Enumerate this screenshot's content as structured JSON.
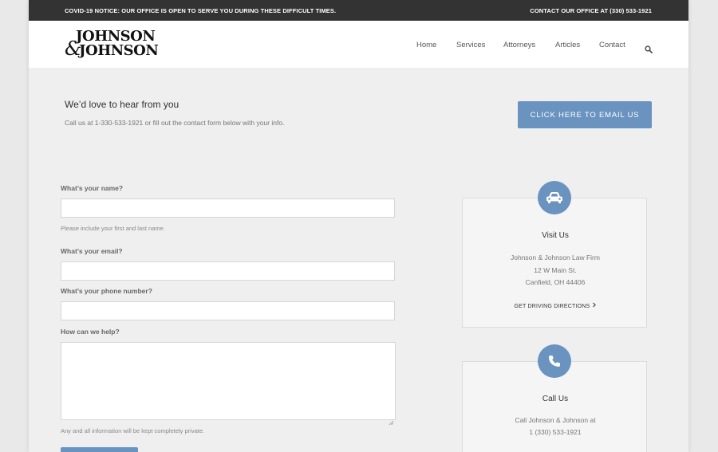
{
  "notice": {
    "left_text": "COVID-19 NOTICE: OUR OFFICE IS OPEN TO SERVE YOU DURING THESE DIFFICULT TIMES.",
    "right_text": "CONTACT OUR OFFICE AT (330) 533-1921"
  },
  "header": {
    "logo": {
      "line1": "JOHNSON",
      "amp": "&",
      "line2": "JOHNSON"
    },
    "nav": [
      "Home",
      "Services",
      "Attorneys",
      "Articles",
      "Contact"
    ],
    "search_icon": "search-icon"
  },
  "intro": {
    "title": "We’d love to hear from you",
    "subtitle": "Call us at 1-330-533-1921 or fill out the contact form below with your info.",
    "email_button": "CLICK HERE TO EMAIL US"
  },
  "form": {
    "name_label": "What’s your name?",
    "name_help": "Please include your first and last name.",
    "email_label": "What’s your email?",
    "phone_label": "What’s your phone number?",
    "message_label": "How can we help?",
    "privacy_note": "Any and all information will be kept completely private."
  },
  "cards": {
    "visit": {
      "icon": "car-icon",
      "title": "Visit Us",
      "line1": "Johnson & Johnson Law Firm",
      "line2": "12 W Main St.",
      "line3": "Canfield, OH 44406",
      "link": "GET DRIVING DIRECTIONS",
      "link_icon": "chevron-right-icon"
    },
    "call": {
      "icon": "phone-icon",
      "title": "Call Us",
      "line1": "Call Johnson & Johnson at",
      "line2": "1 (330) 533-1921"
    }
  },
  "colors": {
    "accent": "#6a93bf",
    "notice_bar": "#333333",
    "page_bg": "#efefef"
  }
}
